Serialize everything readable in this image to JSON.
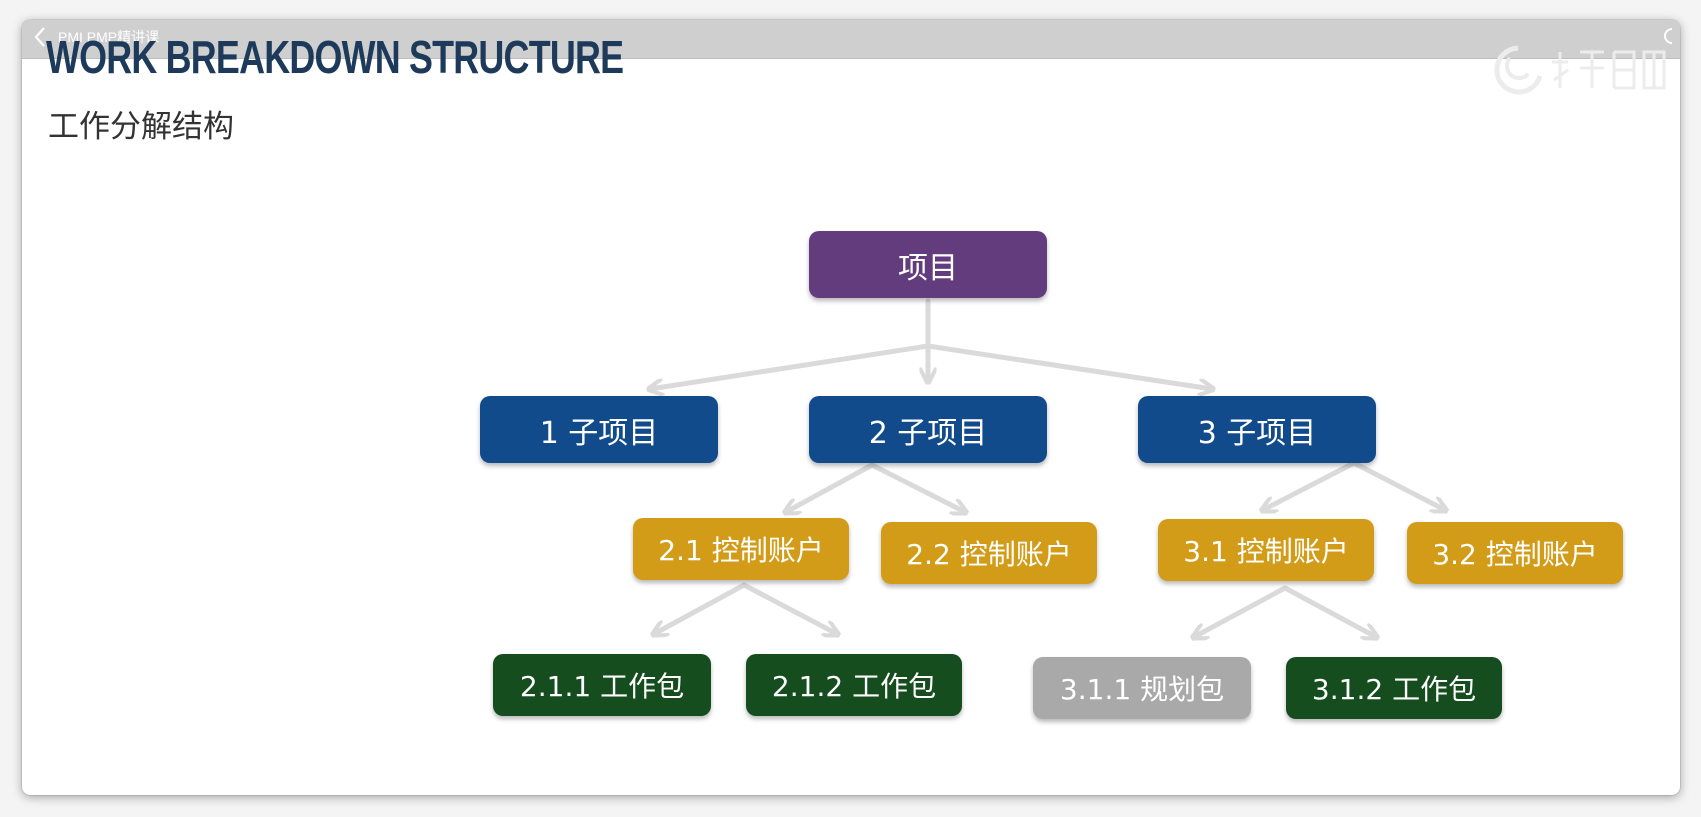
{
  "window": {
    "title": "PMI PMP精讲课"
  },
  "slide": {
    "heading": "WORK BREAKDOWN STRUCTURE",
    "subheading": "工作分解结构"
  },
  "colors": {
    "project": "#633c7e",
    "subproject": "#124b8c",
    "control_account": "#d29c19",
    "work_package": "#154d1f",
    "planning_package": "#a9a9a9",
    "connector": "#dadada",
    "heading": "#1e3a5a"
  },
  "wbs": {
    "project": {
      "label": "项目"
    },
    "subprojects": [
      {
        "label": "1 子项目"
      },
      {
        "label": "2 子项目"
      },
      {
        "label": "3 子项目"
      }
    ],
    "control_accounts": [
      {
        "label": "2.1 控制账户"
      },
      {
        "label": "2.2 控制账户"
      },
      {
        "label": "3.1 控制账户"
      },
      {
        "label": "3.2 控制账户"
      }
    ],
    "packages": [
      {
        "label": "2.1.1 工作包",
        "kind": "work"
      },
      {
        "label": "2.1.2 工作包",
        "kind": "work"
      },
      {
        "label": "3.1.1 规划包",
        "kind": "planning"
      },
      {
        "label": "3.1.2 工作包",
        "kind": "work"
      }
    ]
  }
}
